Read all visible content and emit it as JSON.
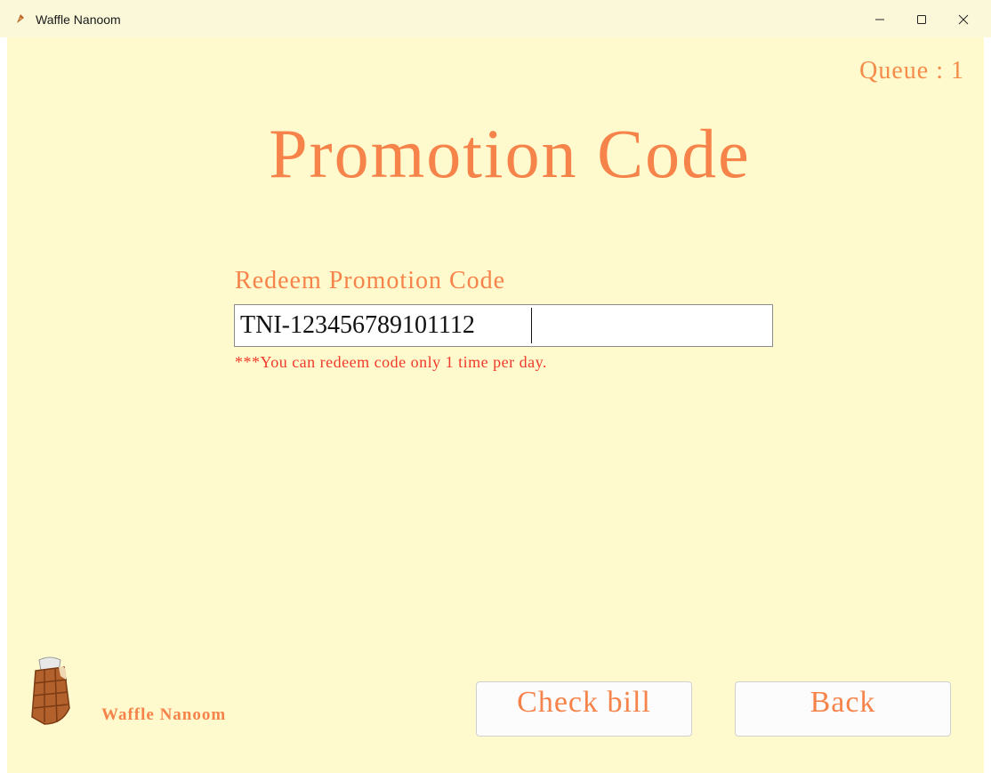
{
  "window": {
    "title": "Waffle Nanoom",
    "app_icon": "waffle-icon",
    "controls": [
      "minimize-icon",
      "maximize-icon",
      "close-icon"
    ]
  },
  "header": {
    "queue_label": "Queue : 1",
    "title": "Promotion Code"
  },
  "form": {
    "label": "Redeem Promotion Code",
    "code_value": "TNI-123456789101112",
    "note": "***You can redeem code only 1 time per day."
  },
  "footer": {
    "brand": "Waffle Nanoom",
    "logo_icon": "waffle-logo-icon",
    "check_bill_label": "Check bill",
    "back_label": "Back"
  },
  "colors": {
    "background": "#fefacd",
    "accent": "#f5834a",
    "warning": "#f03a2a"
  }
}
